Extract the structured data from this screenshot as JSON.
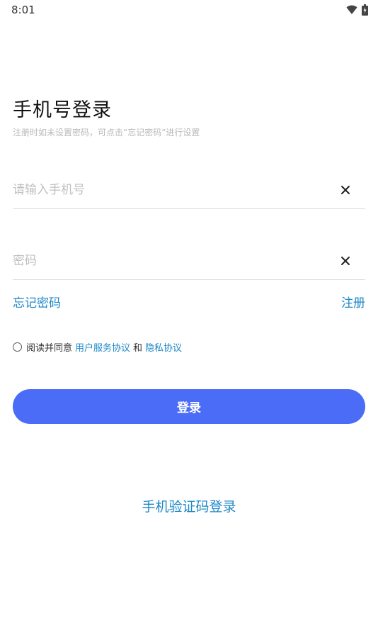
{
  "status_bar": {
    "time": "8:01",
    "icons": [
      "wifi-icon",
      "battery-icon"
    ]
  },
  "login": {
    "title": "手机号登录",
    "subtitle": "注册时如未设置密码，可点击“忘记密码”进行设置",
    "phone": {
      "value": "",
      "placeholder": "请输入手机号"
    },
    "password": {
      "value": "",
      "placeholder": "密码"
    },
    "forgot_password": "忘记密码",
    "register": "注册",
    "agreement": {
      "checked": false,
      "prefix": "阅读并同意",
      "user_agreement": "用户服务协议",
      "conjunction": "和",
      "privacy_agreement": "隐私协议"
    },
    "submit_label": "登录",
    "sms_login": "手机验证码登录"
  },
  "colors": {
    "accent_button": "#4a6cf7",
    "link": "#1e88c8"
  }
}
